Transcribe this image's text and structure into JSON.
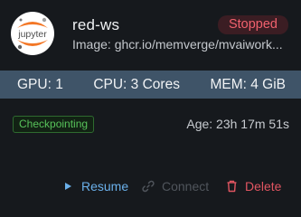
{
  "workspace": {
    "name": "red-ws",
    "status": "Stopped",
    "image_line": "Image: ghcr.io/memverge/mvaiwork...",
    "logo_text": "jupyter"
  },
  "resources": {
    "gpu": "GPU: 1",
    "cpu": "CPU: 3 Cores",
    "mem": "MEM: 4 GiB"
  },
  "meta": {
    "checkpoint_badge": "Checkpointing",
    "age": "Age: 23h 17m 51s"
  },
  "actions": {
    "resume": "Resume",
    "connect": "Connect",
    "delete": "Delete"
  },
  "colors": {
    "background": "#16191d",
    "status_stopped": "#f0616d",
    "resource_bar": "#3f5468",
    "checkpoint_green": "#57c25a",
    "resume_blue": "#6ab0ea",
    "connect_disabled": "#50555c",
    "delete_red": "#e05561",
    "jupyter_orange": "#f37726"
  },
  "icons": {
    "resume": "play-icon",
    "connect": "link-icon",
    "delete": "trash-icon",
    "logo": "jupyter-logo"
  }
}
